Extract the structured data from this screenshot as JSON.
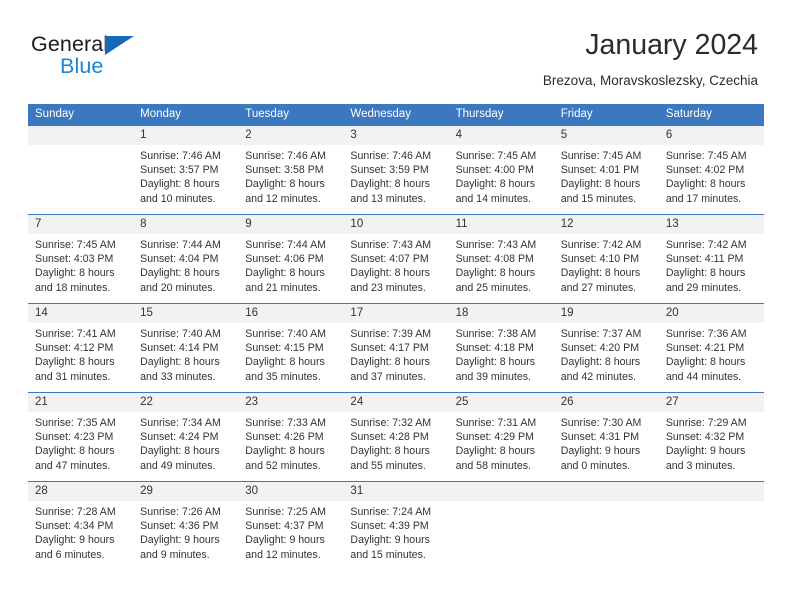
{
  "brand": {
    "word_one": "General",
    "word_two": "Blue",
    "triangle_icon": "triangle-icon"
  },
  "header": {
    "title": "January 2024",
    "subtitle": "Brezova, Moravskoslezsky, Czechia"
  },
  "theme": {
    "header_blue": "#3b78bf",
    "brand_blue": "#1b84d6",
    "logo_triangle_blue": "#1668b8",
    "daynum_band": "#f2f2f2",
    "text": "#333333"
  },
  "weekday_headers": [
    "Sunday",
    "Monday",
    "Tuesday",
    "Wednesday",
    "Thursday",
    "Friday",
    "Saturday"
  ],
  "weeks": [
    [
      {
        "day": "",
        "lines": []
      },
      {
        "day": "1",
        "lines": [
          "Sunrise: 7:46 AM",
          "Sunset: 3:57 PM",
          "Daylight: 8 hours",
          "and 10 minutes."
        ]
      },
      {
        "day": "2",
        "lines": [
          "Sunrise: 7:46 AM",
          "Sunset: 3:58 PM",
          "Daylight: 8 hours",
          "and 12 minutes."
        ]
      },
      {
        "day": "3",
        "lines": [
          "Sunrise: 7:46 AM",
          "Sunset: 3:59 PM",
          "Daylight: 8 hours",
          "and 13 minutes."
        ]
      },
      {
        "day": "4",
        "lines": [
          "Sunrise: 7:45 AM",
          "Sunset: 4:00 PM",
          "Daylight: 8 hours",
          "and 14 minutes."
        ]
      },
      {
        "day": "5",
        "lines": [
          "Sunrise: 7:45 AM",
          "Sunset: 4:01 PM",
          "Daylight: 8 hours",
          "and 15 minutes."
        ]
      },
      {
        "day": "6",
        "lines": [
          "Sunrise: 7:45 AM",
          "Sunset: 4:02 PM",
          "Daylight: 8 hours",
          "and 17 minutes."
        ]
      }
    ],
    [
      {
        "day": "7",
        "lines": [
          "Sunrise: 7:45 AM",
          "Sunset: 4:03 PM",
          "Daylight: 8 hours",
          "and 18 minutes."
        ]
      },
      {
        "day": "8",
        "lines": [
          "Sunrise: 7:44 AM",
          "Sunset: 4:04 PM",
          "Daylight: 8 hours",
          "and 20 minutes."
        ]
      },
      {
        "day": "9",
        "lines": [
          "Sunrise: 7:44 AM",
          "Sunset: 4:06 PM",
          "Daylight: 8 hours",
          "and 21 minutes."
        ]
      },
      {
        "day": "10",
        "lines": [
          "Sunrise: 7:43 AM",
          "Sunset: 4:07 PM",
          "Daylight: 8 hours",
          "and 23 minutes."
        ]
      },
      {
        "day": "11",
        "lines": [
          "Sunrise: 7:43 AM",
          "Sunset: 4:08 PM",
          "Daylight: 8 hours",
          "and 25 minutes."
        ]
      },
      {
        "day": "12",
        "lines": [
          "Sunrise: 7:42 AM",
          "Sunset: 4:10 PM",
          "Daylight: 8 hours",
          "and 27 minutes."
        ]
      },
      {
        "day": "13",
        "lines": [
          "Sunrise: 7:42 AM",
          "Sunset: 4:11 PM",
          "Daylight: 8 hours",
          "and 29 minutes."
        ]
      }
    ],
    [
      {
        "day": "14",
        "lines": [
          "Sunrise: 7:41 AM",
          "Sunset: 4:12 PM",
          "Daylight: 8 hours",
          "and 31 minutes."
        ]
      },
      {
        "day": "15",
        "lines": [
          "Sunrise: 7:40 AM",
          "Sunset: 4:14 PM",
          "Daylight: 8 hours",
          "and 33 minutes."
        ]
      },
      {
        "day": "16",
        "lines": [
          "Sunrise: 7:40 AM",
          "Sunset: 4:15 PM",
          "Daylight: 8 hours",
          "and 35 minutes."
        ]
      },
      {
        "day": "17",
        "lines": [
          "Sunrise: 7:39 AM",
          "Sunset: 4:17 PM",
          "Daylight: 8 hours",
          "and 37 minutes."
        ]
      },
      {
        "day": "18",
        "lines": [
          "Sunrise: 7:38 AM",
          "Sunset: 4:18 PM",
          "Daylight: 8 hours",
          "and 39 minutes."
        ]
      },
      {
        "day": "19",
        "lines": [
          "Sunrise: 7:37 AM",
          "Sunset: 4:20 PM",
          "Daylight: 8 hours",
          "and 42 minutes."
        ]
      },
      {
        "day": "20",
        "lines": [
          "Sunrise: 7:36 AM",
          "Sunset: 4:21 PM",
          "Daylight: 8 hours",
          "and 44 minutes."
        ]
      }
    ],
    [
      {
        "day": "21",
        "lines": [
          "Sunrise: 7:35 AM",
          "Sunset: 4:23 PM",
          "Daylight: 8 hours",
          "and 47 minutes."
        ]
      },
      {
        "day": "22",
        "lines": [
          "Sunrise: 7:34 AM",
          "Sunset: 4:24 PM",
          "Daylight: 8 hours",
          "and 49 minutes."
        ]
      },
      {
        "day": "23",
        "lines": [
          "Sunrise: 7:33 AM",
          "Sunset: 4:26 PM",
          "Daylight: 8 hours",
          "and 52 minutes."
        ]
      },
      {
        "day": "24",
        "lines": [
          "Sunrise: 7:32 AM",
          "Sunset: 4:28 PM",
          "Daylight: 8 hours",
          "and 55 minutes."
        ]
      },
      {
        "day": "25",
        "lines": [
          "Sunrise: 7:31 AM",
          "Sunset: 4:29 PM",
          "Daylight: 8 hours",
          "and 58 minutes."
        ]
      },
      {
        "day": "26",
        "lines": [
          "Sunrise: 7:30 AM",
          "Sunset: 4:31 PM",
          "Daylight: 9 hours",
          "and 0 minutes."
        ]
      },
      {
        "day": "27",
        "lines": [
          "Sunrise: 7:29 AM",
          "Sunset: 4:32 PM",
          "Daylight: 9 hours",
          "and 3 minutes."
        ]
      }
    ],
    [
      {
        "day": "28",
        "lines": [
          "Sunrise: 7:28 AM",
          "Sunset: 4:34 PM",
          "Daylight: 9 hours",
          "and 6 minutes."
        ]
      },
      {
        "day": "29",
        "lines": [
          "Sunrise: 7:26 AM",
          "Sunset: 4:36 PM",
          "Daylight: 9 hours",
          "and 9 minutes."
        ]
      },
      {
        "day": "30",
        "lines": [
          "Sunrise: 7:25 AM",
          "Sunset: 4:37 PM",
          "Daylight: 9 hours",
          "and 12 minutes."
        ]
      },
      {
        "day": "31",
        "lines": [
          "Sunrise: 7:24 AM",
          "Sunset: 4:39 PM",
          "Daylight: 9 hours",
          "and 15 minutes."
        ]
      },
      {
        "day": "",
        "lines": []
      },
      {
        "day": "",
        "lines": []
      },
      {
        "day": "",
        "lines": []
      }
    ]
  ]
}
